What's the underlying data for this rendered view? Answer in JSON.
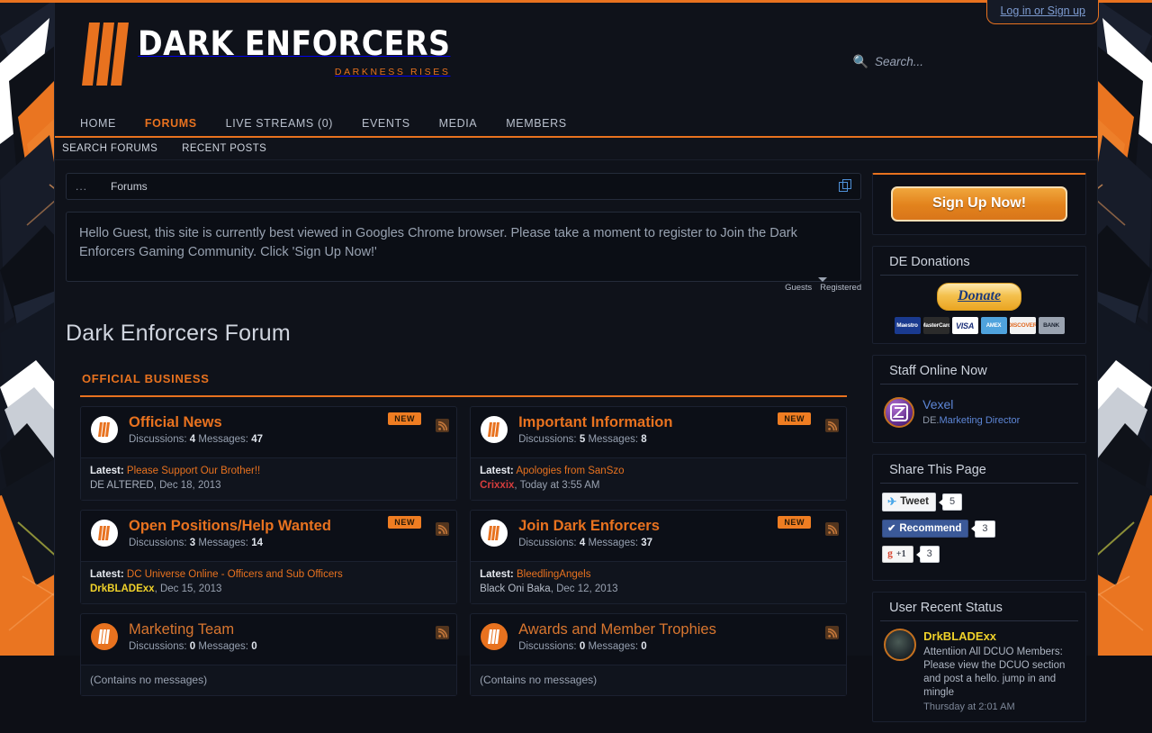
{
  "brand": {
    "title": "DARK ENFORCERS",
    "tagline": "DARKNESS RISES",
    "logo_icon": "three-bars-logo"
  },
  "header": {
    "login_label": "Log in or Sign up",
    "search_placeholder": "Search...",
    "search_icon": "search-icon"
  },
  "nav": {
    "main": [
      {
        "label": "HOME",
        "active": false
      },
      {
        "label": "FORUMS",
        "active": true
      },
      {
        "label": "LIVE STREAMS (0)",
        "active": false
      },
      {
        "label": "EVENTS",
        "active": false
      },
      {
        "label": "MEDIA",
        "active": false
      },
      {
        "label": "MEMBERS",
        "active": false
      }
    ],
    "sub": [
      {
        "label": "SEARCH FORUMS"
      },
      {
        "label": "RECENT POSTS"
      }
    ]
  },
  "breadcrumb": {
    "dots": "...",
    "item": "Forums",
    "jump_icon": "open-in-new-icon"
  },
  "notice": {
    "text": "Hello Guest, this site is currently best viewed in Googles Chrome browser. Please take a moment to register to Join the Dark Enforcers Gaming Community. Click 'Sign Up Now!'"
  },
  "visitors": {
    "guests_label": "Guests",
    "registered_label": "Registered"
  },
  "main": {
    "page_title": "Dark Enforcers Forum",
    "sections": [
      {
        "title": "OFFICIAL BUSINESS",
        "forums": [
          {
            "name": "Official News",
            "unread": true,
            "new_badge": "NEW",
            "stats_prefix": "Discussions:",
            "discussions": "4",
            "messages_prefix": "Messages:",
            "messages": "47",
            "latest_label": "Latest:",
            "latest_title": "Please Support Our Brother!!",
            "latest_user": "DE ALTERED",
            "latest_user_style": "u-grey",
            "latest_date": ", Dec 18, 2013",
            "empty": ""
          },
          {
            "name": "Important Information",
            "unread": true,
            "new_badge": "NEW",
            "stats_prefix": "Discussions:",
            "discussions": "5",
            "messages_prefix": "Messages:",
            "messages": "8",
            "latest_label": "Latest:",
            "latest_title": "Apologies from SanSzo",
            "latest_user": "Crixxix",
            "latest_user_style": "u-red",
            "latest_date": ", Today at 3:55 AM",
            "empty": ""
          },
          {
            "name": "Open Positions/Help Wanted",
            "unread": true,
            "new_badge": "NEW",
            "stats_prefix": "Discussions:",
            "discussions": "3",
            "messages_prefix": "Messages:",
            "messages": "14",
            "latest_label": "Latest:",
            "latest_title": "DC Universe Online - Officers and Sub Officers",
            "latest_user": "DrkBLADExx",
            "latest_user_style": "u-yellow",
            "latest_date": ", Dec 15, 2013",
            "empty": ""
          },
          {
            "name": "Join Dark Enforcers",
            "unread": true,
            "new_badge": "NEW",
            "stats_prefix": "Discussions:",
            "discussions": "4",
            "messages_prefix": "Messages:",
            "messages": "37",
            "latest_label": "Latest:",
            "latest_title": "BleedlingAngels",
            "latest_user": "Black Oni Baka",
            "latest_user_style": "u-plain",
            "latest_date": ", Dec 12, 2013",
            "empty": ""
          },
          {
            "name": "Marketing Team",
            "unread": false,
            "new_badge": "",
            "stats_prefix": "Discussions:",
            "discussions": "0",
            "messages_prefix": "Messages:",
            "messages": "0",
            "latest_label": "",
            "latest_title": "",
            "latest_user": "",
            "latest_user_style": "u-plain",
            "latest_date": "",
            "empty": "(Contains no messages)"
          },
          {
            "name": "Awards and Member Trophies",
            "unread": false,
            "new_badge": "",
            "stats_prefix": "Discussions:",
            "discussions": "0",
            "messages_prefix": "Messages:",
            "messages": "0",
            "latest_label": "",
            "latest_title": "",
            "latest_user": "",
            "latest_user_style": "u-plain",
            "latest_date": "",
            "empty": "(Contains no messages)"
          }
        ]
      }
    ]
  },
  "sidebar": {
    "signup": {
      "label": "Sign Up Now!"
    },
    "donations": {
      "title": "DE Donations",
      "button_label": "Donate",
      "cards": [
        {
          "name": "Maestro",
          "class": "maestro"
        },
        {
          "name": "MasterCard",
          "class": "mc"
        },
        {
          "name": "VISA",
          "class": "visa"
        },
        {
          "name": "AMEX",
          "class": "amex"
        },
        {
          "name": "DISCOVER",
          "class": "discover"
        },
        {
          "name": "BANK",
          "class": "bank"
        }
      ]
    },
    "staff": {
      "title": "Staff Online Now",
      "member_name": "Vexel",
      "member_prefix": "DE.",
      "member_role": "Marketing Director"
    },
    "share": {
      "title": "Share This Page",
      "buttons": [
        {
          "label": "Tweet",
          "count": "5",
          "icon": "twitter-bird-icon",
          "style": "tweet"
        },
        {
          "label": "Recommend",
          "count": "3",
          "icon": "facebook-check-icon",
          "style": "fb"
        },
        {
          "label": "+1",
          "count": "3",
          "icon": "google-plus-icon",
          "style": "gp"
        }
      ]
    },
    "status": {
      "title": "User Recent Status",
      "user": "DrkBLADExx",
      "text": "Attentiion All DCUO Members: Please view the DCUO section and post a hello. jump in and mingle",
      "time": "Thursday at 2:01 AM"
    }
  },
  "colors": {
    "accent": "#e8721f",
    "link": "#5d86d6",
    "page_bg": "#0f121a",
    "panel_bg": "#0c0f17"
  }
}
